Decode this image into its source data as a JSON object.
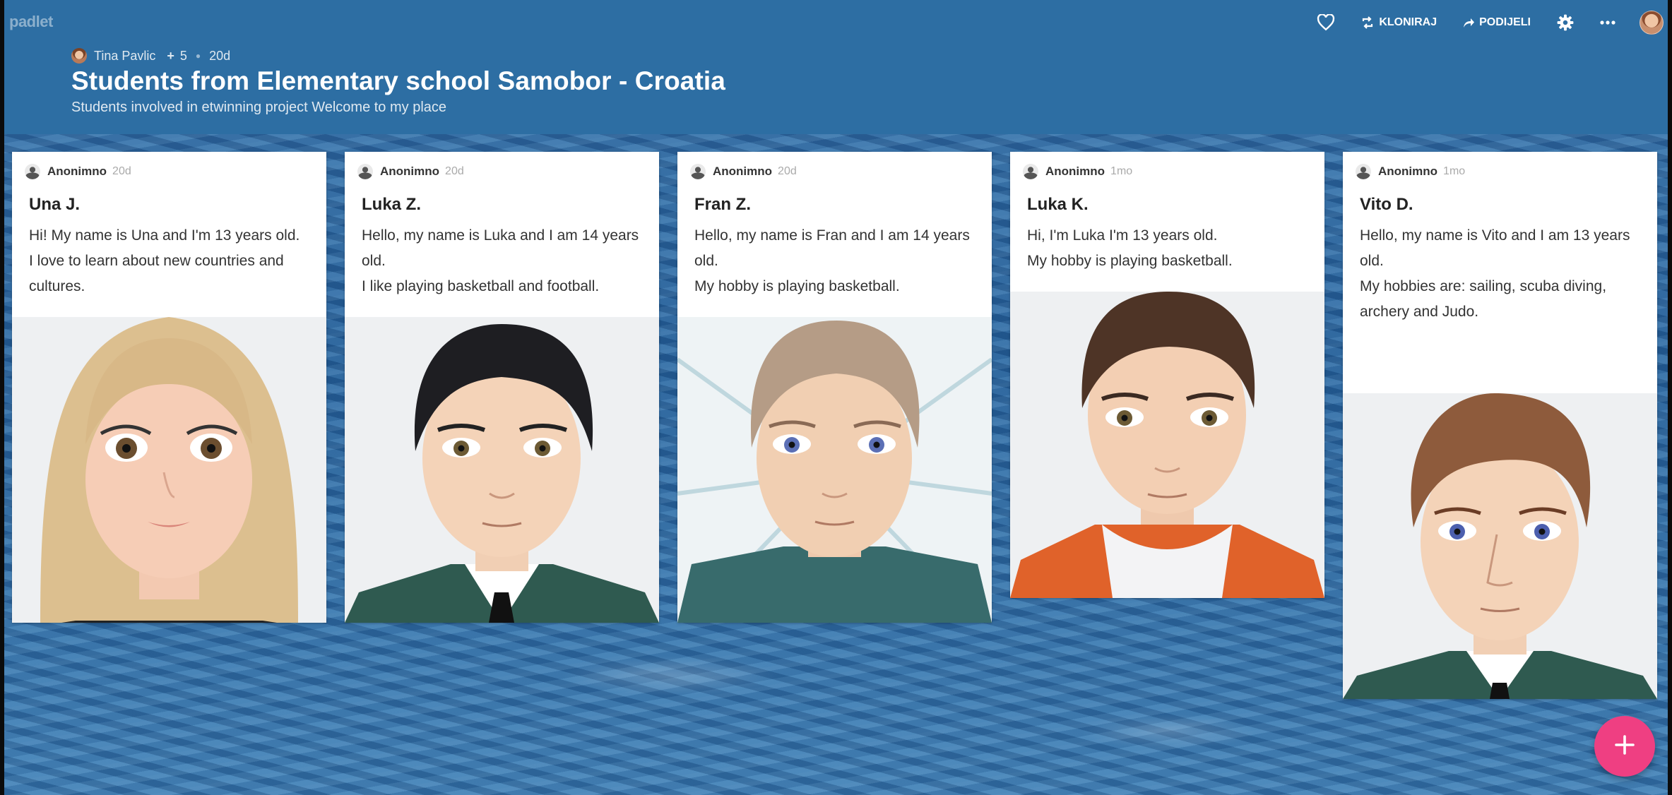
{
  "app": {
    "brand": "padlet"
  },
  "topbar": {
    "clone_label": "KLONIRAJ",
    "share_label": "PODIJELI",
    "icons": [
      "heart-icon",
      "clone-icon",
      "share-icon",
      "gear-icon",
      "more-icon"
    ]
  },
  "board": {
    "author": "Tina Pavlic",
    "collaborators_plus": "+",
    "collaborators_count": "5",
    "age": "20d",
    "title": "Students from Elementary school Samobor - Croatia",
    "subtitle": "Students involved in etwinning project Welcome to my place"
  },
  "posts": [
    {
      "author": "Anonimno",
      "time": "20d",
      "title": "Una J.",
      "body": "Hi! My name is Una and I'm 13 years old.\nI love to learn about new countries and cultures."
    },
    {
      "author": "Anonimno",
      "time": "20d",
      "title": "Luka Z.",
      "body": "Hello, my name is Luka and I am 14 years old.\nI like playing basketball and football."
    },
    {
      "author": "Anonimno",
      "time": "20d",
      "title": "Fran Z.",
      "body": "Hello, my name is Fran and I am 14 years old.\nMy hobby is playing basketball."
    },
    {
      "author": "Anonimno",
      "time": "1mo",
      "title": "Luka K.",
      "body": "Hi, I'm Luka I'm 13 years old.\nMy hobby is playing basketball."
    },
    {
      "author": "Anonimno",
      "time": "1mo",
      "title": "Vito D.",
      "body": "Hello, my name is Vito and I am 13 years old.\nMy hobbies are: sailing, scuba diving, archery and Judo."
    }
  ],
  "fab": {
    "icon": "plus-icon"
  },
  "colors": {
    "header": "#2d6ea3",
    "fab": "#ef3f82"
  }
}
